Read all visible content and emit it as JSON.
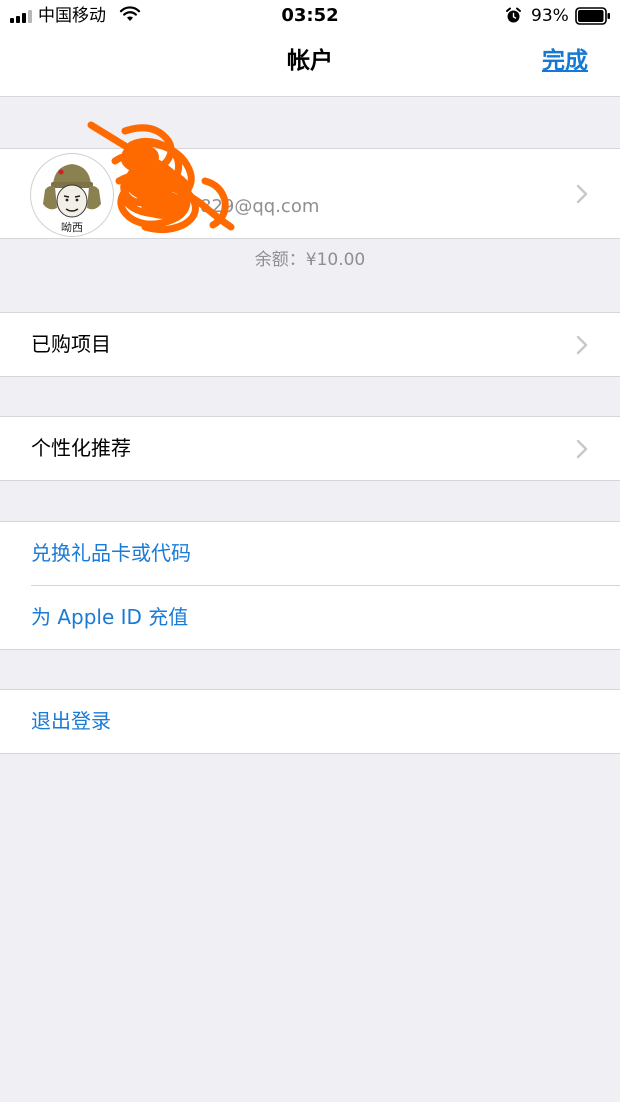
{
  "status_bar": {
    "carrier": "中国移动",
    "time": "03:52",
    "battery": "93%"
  },
  "nav": {
    "title": "帐户",
    "done": "完成"
  },
  "account": {
    "avatar_caption": "呦西",
    "email": "829@qq.com",
    "balance": "余额：¥10.00"
  },
  "menu": {
    "purchased": "已购项目",
    "personalized": "个性化推荐",
    "redeem": "兑换礼品卡或代码",
    "add_funds": "为 Apple ID 充值",
    "sign_out": "退出登录"
  },
  "colors": {
    "accent": "#1479d4",
    "background": "#efeff4",
    "scribble": "#ff6a00"
  },
  "icons": [
    "signal-icon",
    "wifi-icon",
    "alarm-icon",
    "battery-icon",
    "chevron-right-icon"
  ]
}
